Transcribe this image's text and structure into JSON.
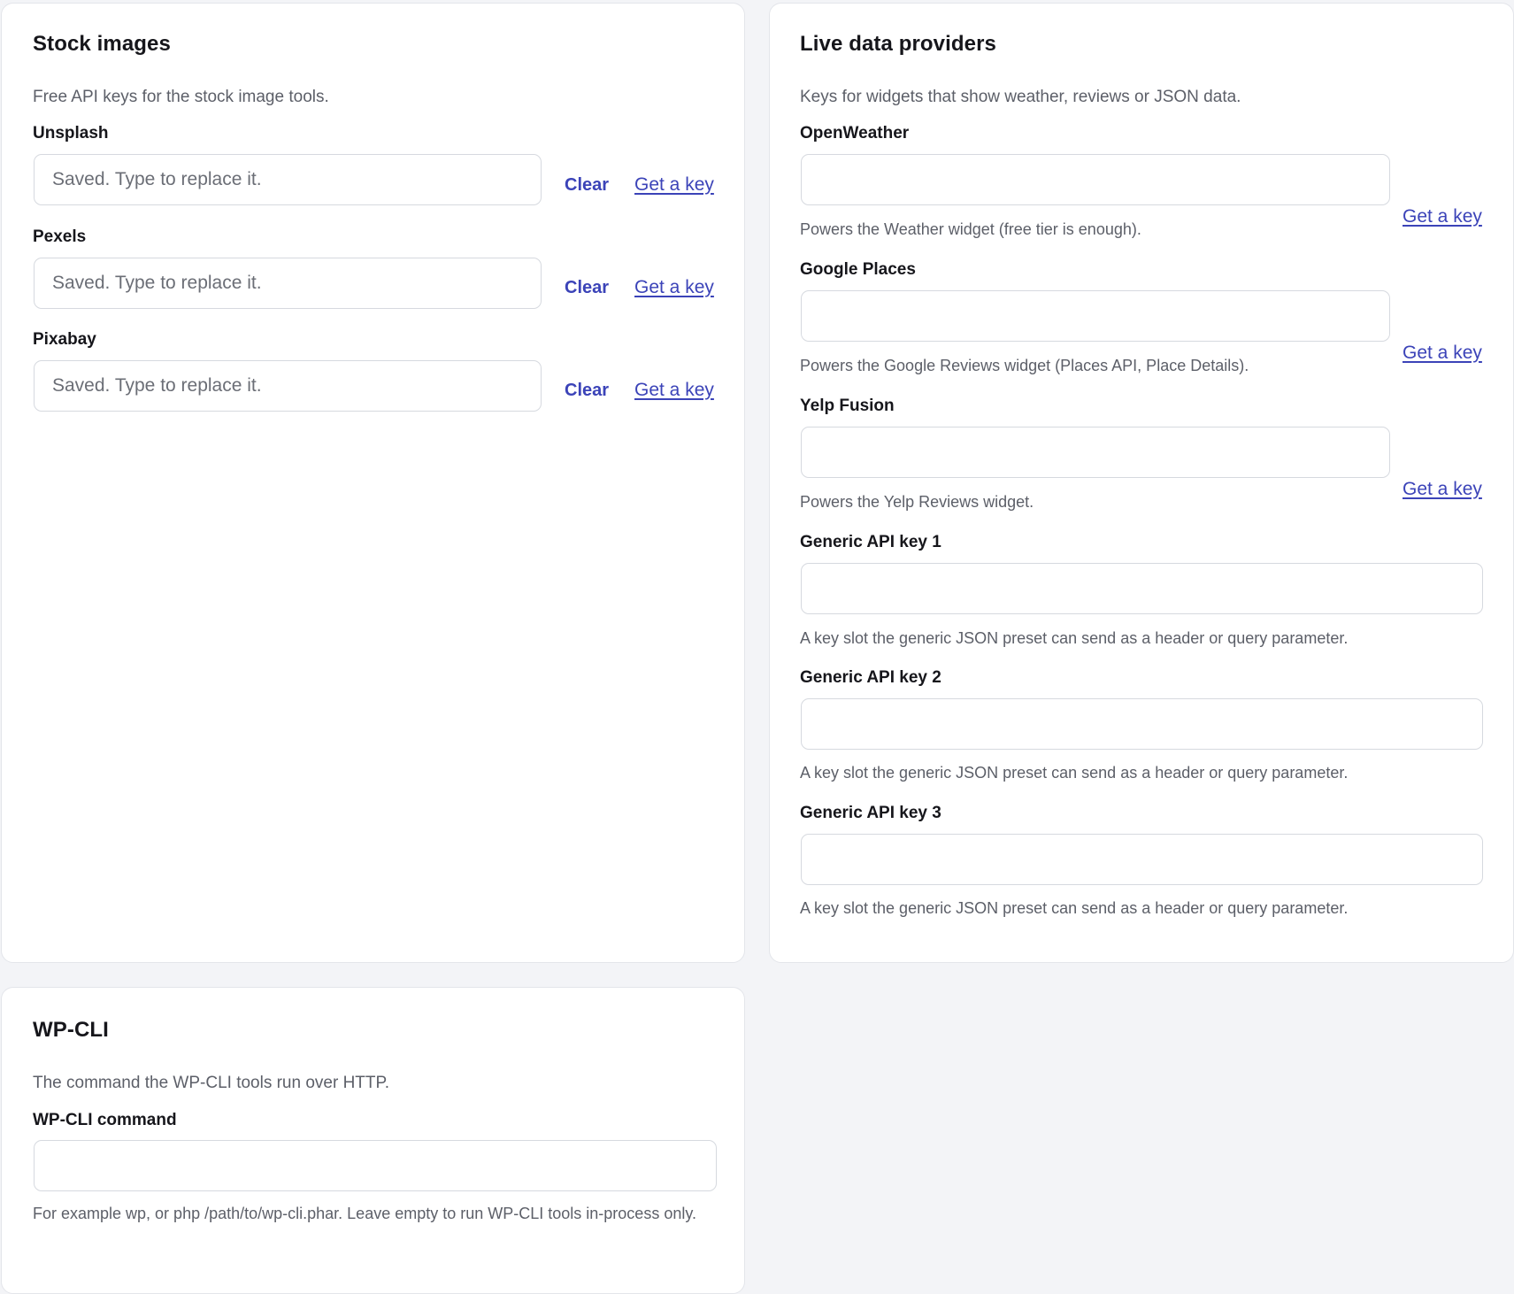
{
  "stock": {
    "title": "Stock images",
    "description": "Free API keys for the stock image tools.",
    "fields": [
      {
        "label": "Unsplash",
        "placeholder": "Saved. Type to replace it.",
        "clear_label": "Clear",
        "link_label": "Get a key"
      },
      {
        "label": "Pexels",
        "placeholder": "Saved. Type to replace it.",
        "clear_label": "Clear",
        "link_label": "Get a key"
      },
      {
        "label": "Pixabay",
        "placeholder": "Saved. Type to replace it.",
        "clear_label": "Clear",
        "link_label": "Get a key"
      }
    ]
  },
  "live": {
    "title": "Live data providers",
    "description": "Keys for widgets that show weather, reviews or JSON data.",
    "fields": [
      {
        "label": "OpenWeather",
        "value": "",
        "help": "Powers the Weather widget (free tier is enough).",
        "link_label": "Get a key"
      },
      {
        "label": "Google Places",
        "value": "",
        "help": "Powers the Google Reviews widget (Places API, Place Details).",
        "link_label": "Get a key"
      },
      {
        "label": "Yelp Fusion",
        "value": "",
        "help": "Powers the Yelp Reviews widget.",
        "link_label": "Get a key"
      },
      {
        "label": "Generic API key 1",
        "value": "",
        "help": "A key slot the generic JSON preset can send as a header or query parameter."
      },
      {
        "label": "Generic API key 2",
        "value": "",
        "help": "A key slot the generic JSON preset can send as a header or query parameter."
      },
      {
        "label": "Generic API key 3",
        "value": "",
        "help": "A key slot the generic JSON preset can send as a header or query parameter."
      }
    ]
  },
  "wpcli": {
    "title": "WP-CLI",
    "description": "The command the WP-CLI tools run over HTTP.",
    "field_label": "WP-CLI command",
    "value": "",
    "help": "For example wp, or php /path/to/wp-cli.phar. Leave empty to run WP-CLI tools in-process only."
  },
  "colors": {
    "accent": "#3b43b8",
    "page_background": "#f3f4f7",
    "card_background": "#ffffff",
    "muted_text": "#5c5f68"
  }
}
